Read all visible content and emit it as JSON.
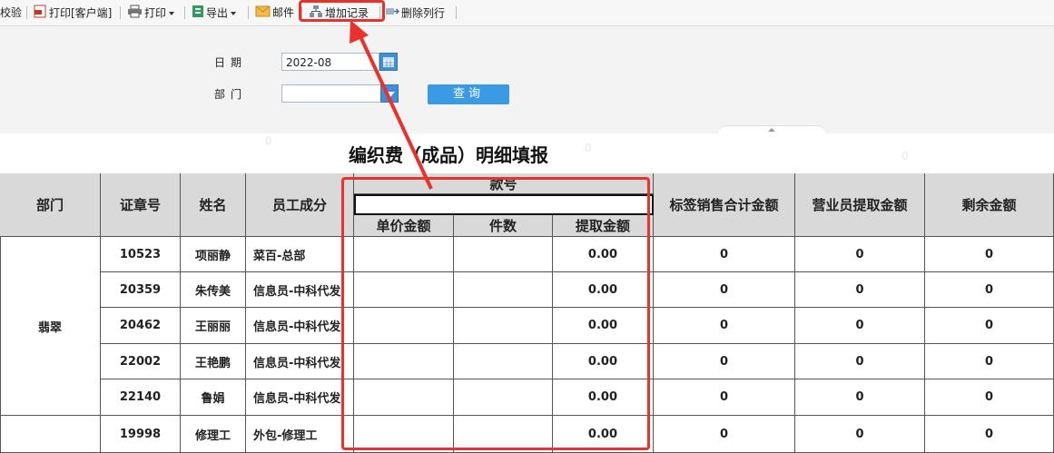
{
  "toolbar": {
    "verify": "校验",
    "print_client": "打印[客户端]",
    "print": "打印",
    "export": "导出",
    "mail": "邮件",
    "add_record": "增加记录",
    "delete_row": "删除列行"
  },
  "query": {
    "date_label": "日期",
    "date_value": "2022-08",
    "dept_label": "部门",
    "dept_value": "",
    "search_button": "查询"
  },
  "report": {
    "title": "编织费（成品）明细填报",
    "headers": {
      "dept": "部门",
      "badge": "证章号",
      "name": "姓名",
      "staff_type": "员工成分",
      "style_no": "款号",
      "unit_price": "单价金额",
      "pieces": "件数",
      "extract_amount": "提取金额",
      "label_sales_total": "标签销售合计金额",
      "salesman_extract": "营业员提取金额",
      "remaining": "剩余金额"
    },
    "group_dept": "翡翠",
    "rows": [
      {
        "badge": "10523",
        "name": "项丽静",
        "staff_type": "菜百-总部",
        "unit_price": "",
        "pieces": "",
        "extract": "0.00",
        "label_total": "0",
        "salesman": "0",
        "remaining": "0"
      },
      {
        "badge": "20359",
        "name": "朱传美",
        "staff_type": "信息员-中科代发",
        "unit_price": "",
        "pieces": "",
        "extract": "0.00",
        "label_total": "0",
        "salesman": "0",
        "remaining": "0"
      },
      {
        "badge": "20462",
        "name": "王丽丽",
        "staff_type": "信息员-中科代发",
        "unit_price": "",
        "pieces": "",
        "extract": "0.00",
        "label_total": "0",
        "salesman": "0",
        "remaining": "0"
      },
      {
        "badge": "22002",
        "name": "王艳鹏",
        "staff_type": "信息员-中科代发",
        "unit_price": "",
        "pieces": "",
        "extract": "0.00",
        "label_total": "0",
        "salesman": "0",
        "remaining": "0"
      },
      {
        "badge": "22140",
        "name": "鲁娟",
        "staff_type": "信息员-中科代发",
        "unit_price": "",
        "pieces": "",
        "extract": "0.00",
        "label_total": "0",
        "salesman": "0",
        "remaining": "0"
      },
      {
        "badge": "19998",
        "name": "修理工",
        "staff_type": "外包-修理工",
        "unit_price": "",
        "pieces": "",
        "extract": "0.00",
        "label_total": "0",
        "salesman": "0",
        "remaining": "0"
      }
    ]
  },
  "colors": {
    "annotation": "#e8322b",
    "header_bg": "#d9d9d9",
    "button": "#3a9ae6"
  }
}
